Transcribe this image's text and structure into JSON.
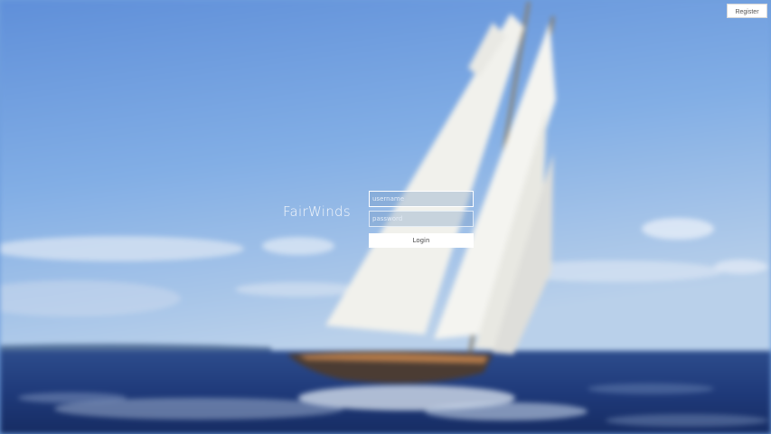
{
  "header": {
    "register_label": "Register"
  },
  "brand": {
    "name": "FairWinds"
  },
  "login": {
    "username_placeholder": "username",
    "username_value": "",
    "password_placeholder": "password",
    "password_value": "",
    "submit_label": "Login"
  },
  "colors": {
    "sky": "#6f9fdc",
    "sea": "#1c3576",
    "sail": "#f2f2ee",
    "button": "#ffffff"
  }
}
